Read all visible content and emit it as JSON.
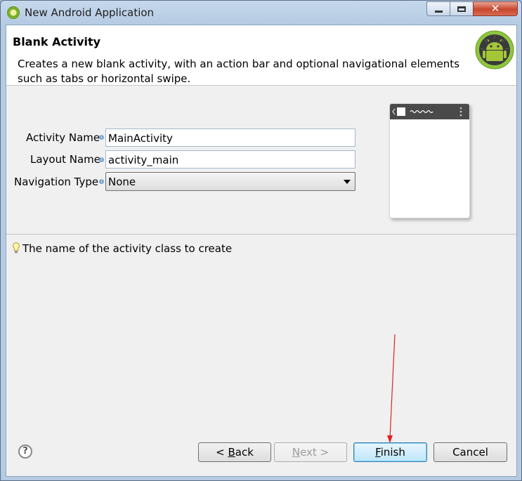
{
  "window": {
    "title": "New Android Application",
    "app_icon": "android-adt-icon",
    "controls": [
      "minimize-icon",
      "maximize-icon",
      "close-icon"
    ]
  },
  "header": {
    "title": "Blank Activity",
    "description": "Creates a new blank activity, with an action bar and optional navigational elements such as tabs or horizontal swipe.",
    "logo": "android-logo-icon"
  },
  "form": {
    "activity_name": {
      "label": "Activity Name",
      "value": "MainActivity"
    },
    "layout_name": {
      "label": "Layout Name",
      "value": "activity_main"
    },
    "navigation_type": {
      "label": "Navigation Type",
      "value": "None"
    }
  },
  "hint": {
    "icon": "lightbulb-icon",
    "text": "The name of the activity class to create"
  },
  "buttons": {
    "back": {
      "underline": "B",
      "rest": "ack",
      "prefix": "< "
    },
    "next": {
      "underline": "N",
      "rest": "ext >"
    },
    "finish": {
      "underline": "F",
      "rest": "inish"
    },
    "cancel": "Cancel",
    "help": "?"
  },
  "colors": {
    "annotation_arrow": "#e02020"
  }
}
